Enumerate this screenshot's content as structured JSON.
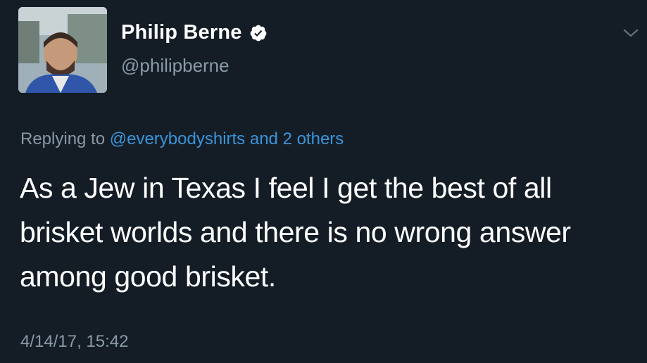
{
  "tweet": {
    "author": {
      "name": "Philip Berne",
      "handle": "@philipberne",
      "verified": true
    },
    "reply": {
      "prefix": "Replying to",
      "users": "@everybodyshirts and 2 others"
    },
    "text": "As a Jew in Texas I feel I get the best of all brisket worlds and there is no wrong answer among good brisket.",
    "timestamp": "4/14/17, 15:42"
  },
  "colors": {
    "background": "#141d26",
    "text": "#ffffff",
    "secondary": "#8899a6",
    "link": "#3b94d9",
    "verified": "#ffffff"
  },
  "icons": {
    "verified": "verified-badge-icon",
    "menu": "chevron-down-icon"
  }
}
